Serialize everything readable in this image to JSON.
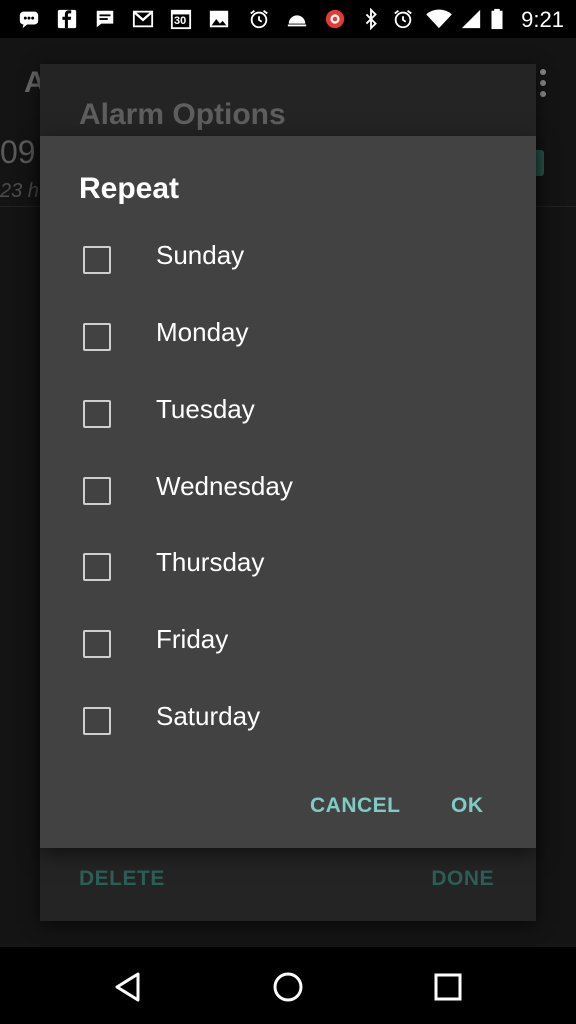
{
  "status_bar": {
    "time": "9:21",
    "icons": [
      "chat-icon",
      "facebook-icon",
      "message-icon",
      "gmail-icon",
      "calendar-icon",
      "image-icon",
      "alarm-icon",
      "weather-icon",
      "app-icon",
      "bluetooth-icon",
      "alarm-icon",
      "wifi-icon",
      "signal-icon",
      "battery-icon"
    ],
    "calendar_day": "30"
  },
  "background_app": {
    "title": "A",
    "alarm_time": "09",
    "alarm_sub": "23 h"
  },
  "alarm_options_dialog": {
    "title": "Alarm Options",
    "delete_label": "DELETE",
    "done_label": "DONE"
  },
  "repeat_dialog": {
    "title": "Repeat",
    "days": [
      {
        "label": "Sunday",
        "checked": false
      },
      {
        "label": "Monday",
        "checked": false
      },
      {
        "label": "Tuesday",
        "checked": false
      },
      {
        "label": "Wednesday",
        "checked": false
      },
      {
        "label": "Thursday",
        "checked": false
      },
      {
        "label": "Friday",
        "checked": false
      },
      {
        "label": "Saturday",
        "checked": false
      }
    ],
    "cancel_label": "CANCEL",
    "ok_label": "OK",
    "accent_color": "#80cbc4"
  },
  "nav_bar": {
    "buttons": [
      "back-icon",
      "home-icon",
      "recents-icon"
    ]
  }
}
